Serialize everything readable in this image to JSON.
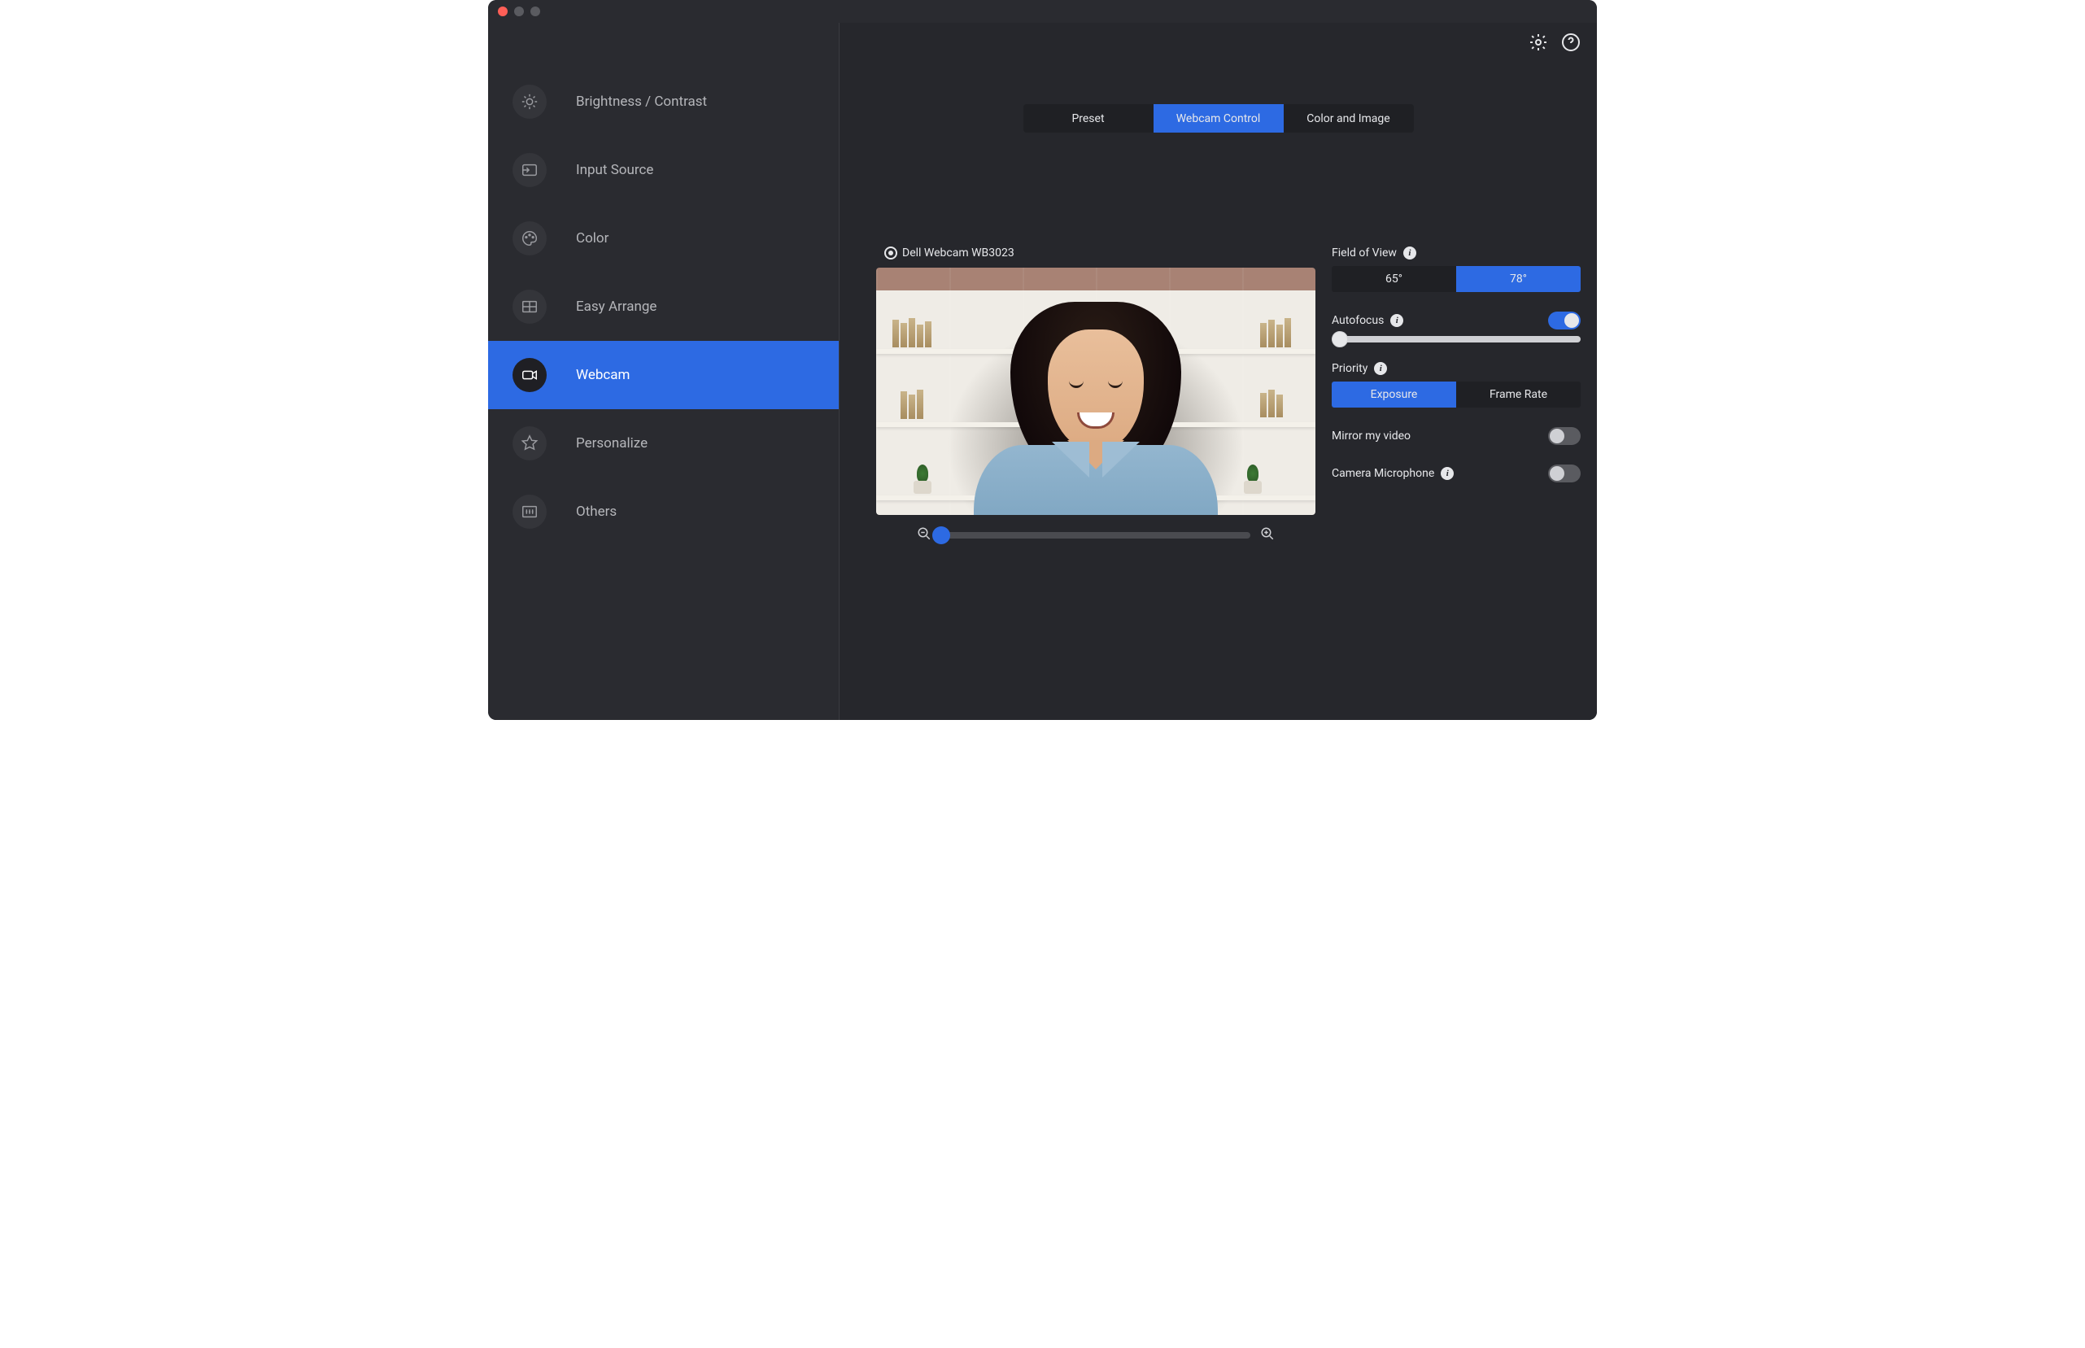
{
  "sidebar": {
    "items": [
      {
        "label": "Brightness / Contrast"
      },
      {
        "label": "Input Source"
      },
      {
        "label": "Color"
      },
      {
        "label": "Easy Arrange"
      },
      {
        "label": "Webcam"
      },
      {
        "label": "Personalize"
      },
      {
        "label": "Others"
      }
    ]
  },
  "tabs": {
    "preset": "Preset",
    "webcam_control": "Webcam Control",
    "color_image": "Color and Image"
  },
  "camera": {
    "name": "Dell Webcam WB3023"
  },
  "controls": {
    "fov_label": "Field of View",
    "fov_options": {
      "opt1": "65°",
      "opt2": "78°"
    },
    "autofocus_label": "Autofocus",
    "priority_label": "Priority",
    "priority_options": {
      "opt1": "Exposure",
      "opt2": "Frame Rate"
    },
    "mirror_label": "Mirror my video",
    "mic_label": "Camera Microphone"
  }
}
